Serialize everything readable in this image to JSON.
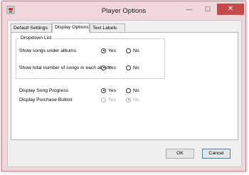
{
  "window": {
    "title": "Player Options",
    "controls": {
      "minimize": "—",
      "maximize": "☐",
      "close": "✕"
    }
  },
  "tabs": [
    {
      "label": "Default Settings",
      "active": false
    },
    {
      "label": "Display Options",
      "active": true
    },
    {
      "label": "Text Labels",
      "active": false
    }
  ],
  "dropdown_group": {
    "title": "Dropdown List",
    "options": [
      {
        "label": "Show songs under albums",
        "yes": "Yes",
        "no": "No",
        "selected": "Yes"
      },
      {
        "label": "Show total number of songs in each album",
        "yes": "Yes",
        "no": "No",
        "selected": "Yes"
      }
    ]
  },
  "options": [
    {
      "label": "Display Song Progress",
      "yes": "Yes",
      "no": "No",
      "selected": "Yes",
      "enabled": true
    },
    {
      "label": "Display Purchase Button",
      "yes": "Yes",
      "no": "No",
      "selected": "No",
      "enabled": false
    }
  ],
  "buttons": {
    "ok": "OK",
    "cancel": "Cancel"
  },
  "colors": {
    "frame": "#f0d7dc",
    "close": "#c74a4a"
  },
  "icons": [
    "app-icon",
    "minimize-icon",
    "maximize-icon",
    "close-icon"
  ]
}
